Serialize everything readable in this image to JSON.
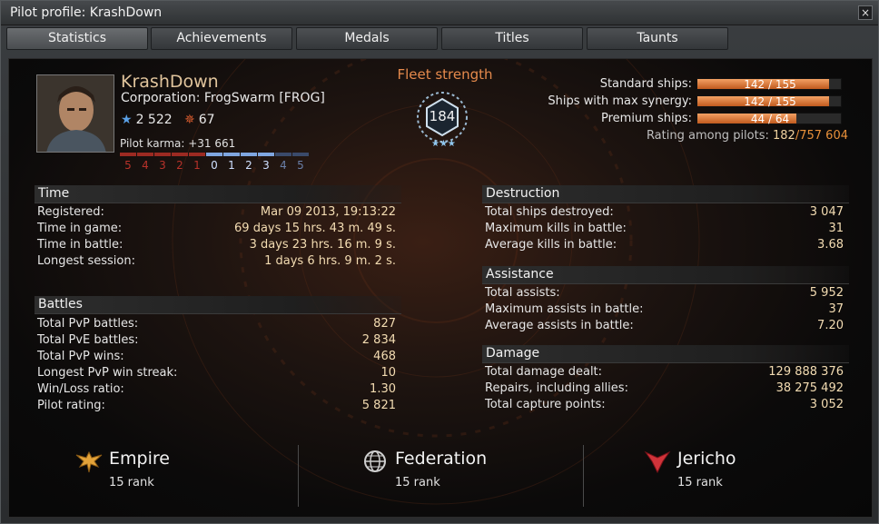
{
  "window": {
    "title": "Pilot profile: KrashDown",
    "close_icon": "×"
  },
  "tabs": [
    {
      "label": "Statistics",
      "active": true
    },
    {
      "label": "Achievements"
    },
    {
      "label": "Medals"
    },
    {
      "label": "Titles"
    },
    {
      "label": "Taunts"
    }
  ],
  "pilot": {
    "name": "KrashDown",
    "corporation": "Corporation: FrogSwarm [FROG]",
    "stat_a": "2 522",
    "stat_b": "67",
    "karma": "Pilot karma: +31 661",
    "karma_scale": [
      "5",
      "4",
      "3",
      "2",
      "1",
      "0",
      "1",
      "2",
      "3",
      "4",
      "5"
    ],
    "karma_level": 3
  },
  "fleet": {
    "title": "Fleet strength",
    "value": "184"
  },
  "ships": [
    {
      "label": "Standard ships:",
      "value": "142 / 155",
      "fraction": 0.916
    },
    {
      "label": "Ships with max synergy:",
      "value": "142 / 155",
      "fraction": 0.916
    },
    {
      "label": "Premium ships:",
      "value": "44 / 64",
      "fraction": 0.6875
    }
  ],
  "rating": {
    "label": "Rating among pilots:",
    "rank": "182",
    "total": "757 604"
  },
  "time": {
    "header": "Time",
    "rows": [
      {
        "k": "Registered:",
        "v": "Mar 09 2013, 19:13:22"
      },
      {
        "k": "Time in game:",
        "v": "69 days 15 hrs. 43 m. 49 s."
      },
      {
        "k": "Time in battle:",
        "v": "3 days 23 hrs. 16 m. 9 s."
      },
      {
        "k": "Longest session:",
        "v": "1 days 6 hrs. 9 m. 2 s."
      }
    ]
  },
  "battles": {
    "header": "Battles",
    "rows": [
      {
        "k": "Total PvP battles:",
        "v": "827"
      },
      {
        "k": "Total PvE battles:",
        "v": "2 834"
      },
      {
        "k": "Total PvP wins:",
        "v": "468"
      },
      {
        "k": "Longest PvP win streak:",
        "v": "10"
      },
      {
        "k": "Win/Loss ratio:",
        "v": "1.30"
      },
      {
        "k": "Pilot rating:",
        "v": "5 821"
      }
    ]
  },
  "destruction": {
    "header": "Destruction",
    "rows": [
      {
        "k": "Total ships destroyed:",
        "v": "3 047"
      },
      {
        "k": "Maximum kills in battle:",
        "v": "31"
      },
      {
        "k": "Average kills in battle:",
        "v": "3.68"
      }
    ]
  },
  "assistance": {
    "header": "Assistance",
    "rows": [
      {
        "k": "Total assists:",
        "v": "5 952"
      },
      {
        "k": "Maximum assists in battle:",
        "v": "37"
      },
      {
        "k": "Average assists in battle:",
        "v": "7.20"
      }
    ]
  },
  "damage": {
    "header": "Damage",
    "rows": [
      {
        "k": "Total damage dealt:",
        "v": "129 888 376"
      },
      {
        "k": "Repairs, including allies:",
        "v": "38 275 492"
      },
      {
        "k": "Total capture points:",
        "v": "3 052"
      }
    ]
  },
  "factions": [
    {
      "name": "Empire",
      "rank": "15 rank",
      "icon": "empire-eagle-icon",
      "color": "#e3a33a"
    },
    {
      "name": "Federation",
      "rank": "15 rank",
      "icon": "federation-globe-icon",
      "color": "#cfcfcf"
    },
    {
      "name": "Jericho",
      "rank": "15 rank",
      "icon": "jericho-emblem-icon",
      "color": "#d0333a"
    }
  ],
  "colors": {
    "accent_orange": "#e58a4c",
    "value_text": "#f3dcb2",
    "karma_negative": "#9b2a22",
    "karma_positive": "#7fa6e0",
    "bar_fill": "#e07a3a"
  }
}
